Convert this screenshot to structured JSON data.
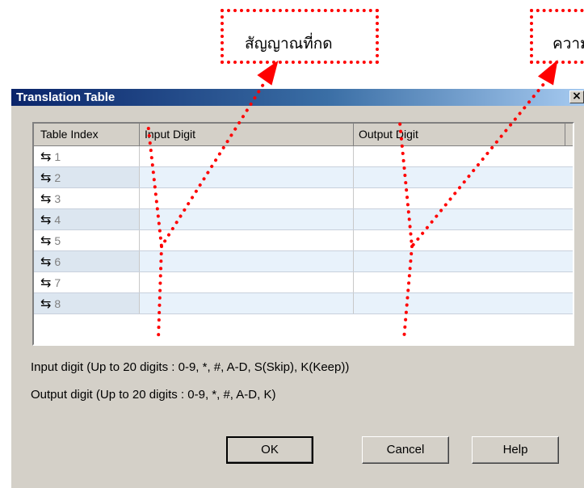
{
  "callouts": {
    "left_text": "สัญญาณที่กด",
    "right_text": "ความ"
  },
  "dialog": {
    "title": "Translation Table",
    "close_glyph": "×",
    "grid": {
      "headers": [
        "Table Index",
        "Input Digit",
        "Output Digit"
      ],
      "rows": [
        {
          "index": "1",
          "input": "",
          "output": ""
        },
        {
          "index": "2",
          "input": "",
          "output": ""
        },
        {
          "index": "3",
          "input": "",
          "output": ""
        },
        {
          "index": "4",
          "input": "",
          "output": ""
        },
        {
          "index": "5",
          "input": "",
          "output": ""
        },
        {
          "index": "6",
          "input": "",
          "output": ""
        },
        {
          "index": "7",
          "input": "",
          "output": ""
        },
        {
          "index": "8",
          "input": "",
          "output": ""
        }
      ],
      "row_icon": "⇆"
    },
    "hints": {
      "input": "Input digit (Up to 20 digits : 0-9, *, #, A-D, S(Skip), K(Keep))",
      "output": "Output digit (Up to 20 digits : 0-9, *, #, A-D, K)"
    },
    "buttons": {
      "ok": "OK",
      "cancel": "Cancel",
      "help": "Help"
    }
  },
  "colors": {
    "annotation": "#ff0000",
    "title_bar_start": "#0a246a",
    "dialog_face": "#d4d0c8"
  }
}
